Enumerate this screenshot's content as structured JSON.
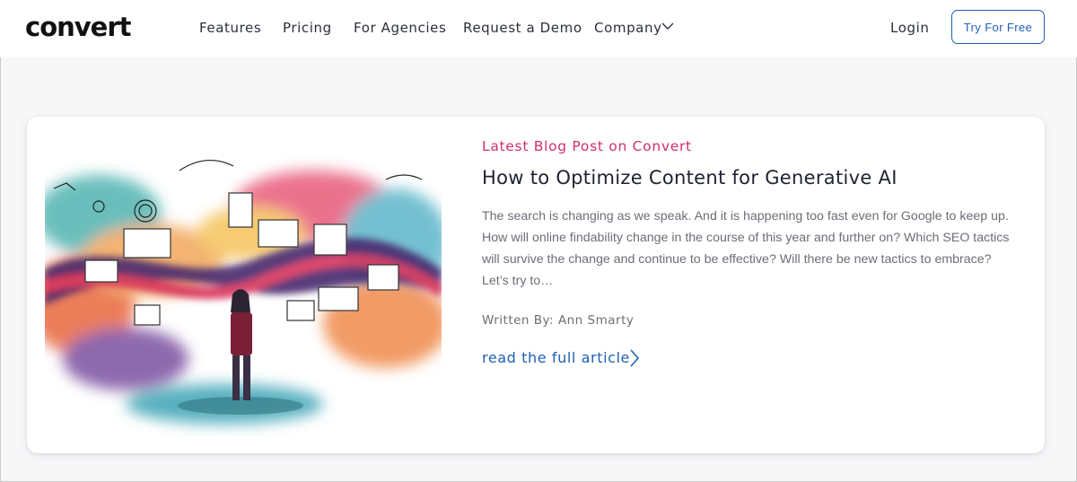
{
  "brand": {
    "logo_text": "convert"
  },
  "nav": {
    "items": [
      "Features",
      "Pricing",
      "For Agencies",
      "Request a Demo",
      "Company"
    ],
    "login_label": "Login",
    "cta_label": "Try For Free"
  },
  "post": {
    "eyebrow": "Latest Blog Post on Convert",
    "title": "How to Optimize Content for Generative AI",
    "excerpt": "The search is changing as we speak. And it is happening too fast even for Google to keep up. How will online findability change in the course of this year and further on? Which SEO tactics will survive the change and continue to be effective? Will there be new tactics to embrace? Let’s try to…",
    "author": "Written By: Ann Smarty",
    "read_more": "read the full article"
  },
  "colors": {
    "accent": "#1f5fb4",
    "eyebrow": "#d12e6e",
    "text": "#1f2230",
    "muted": "#6b6e78"
  }
}
